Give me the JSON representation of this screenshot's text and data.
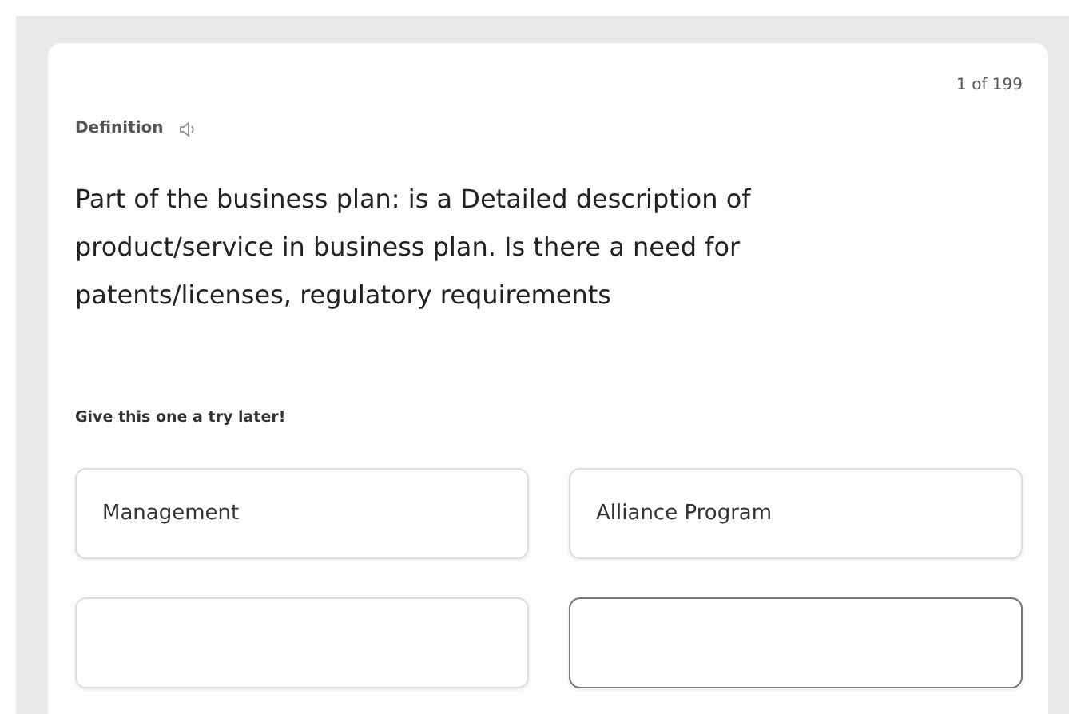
{
  "counter": "1 of 199",
  "term_label": "Definition",
  "definition": "Part of the business plan: is a Detailed description of product/service in business plan. Is there a need for patents/licenses, regulatory requirements",
  "hint": "Give this one a try later!",
  "options": [
    {
      "label": "Management",
      "selected": false
    },
    {
      "label": "Alliance Program",
      "selected": false
    },
    {
      "selected": false
    },
    {
      "selected": true
    }
  ]
}
